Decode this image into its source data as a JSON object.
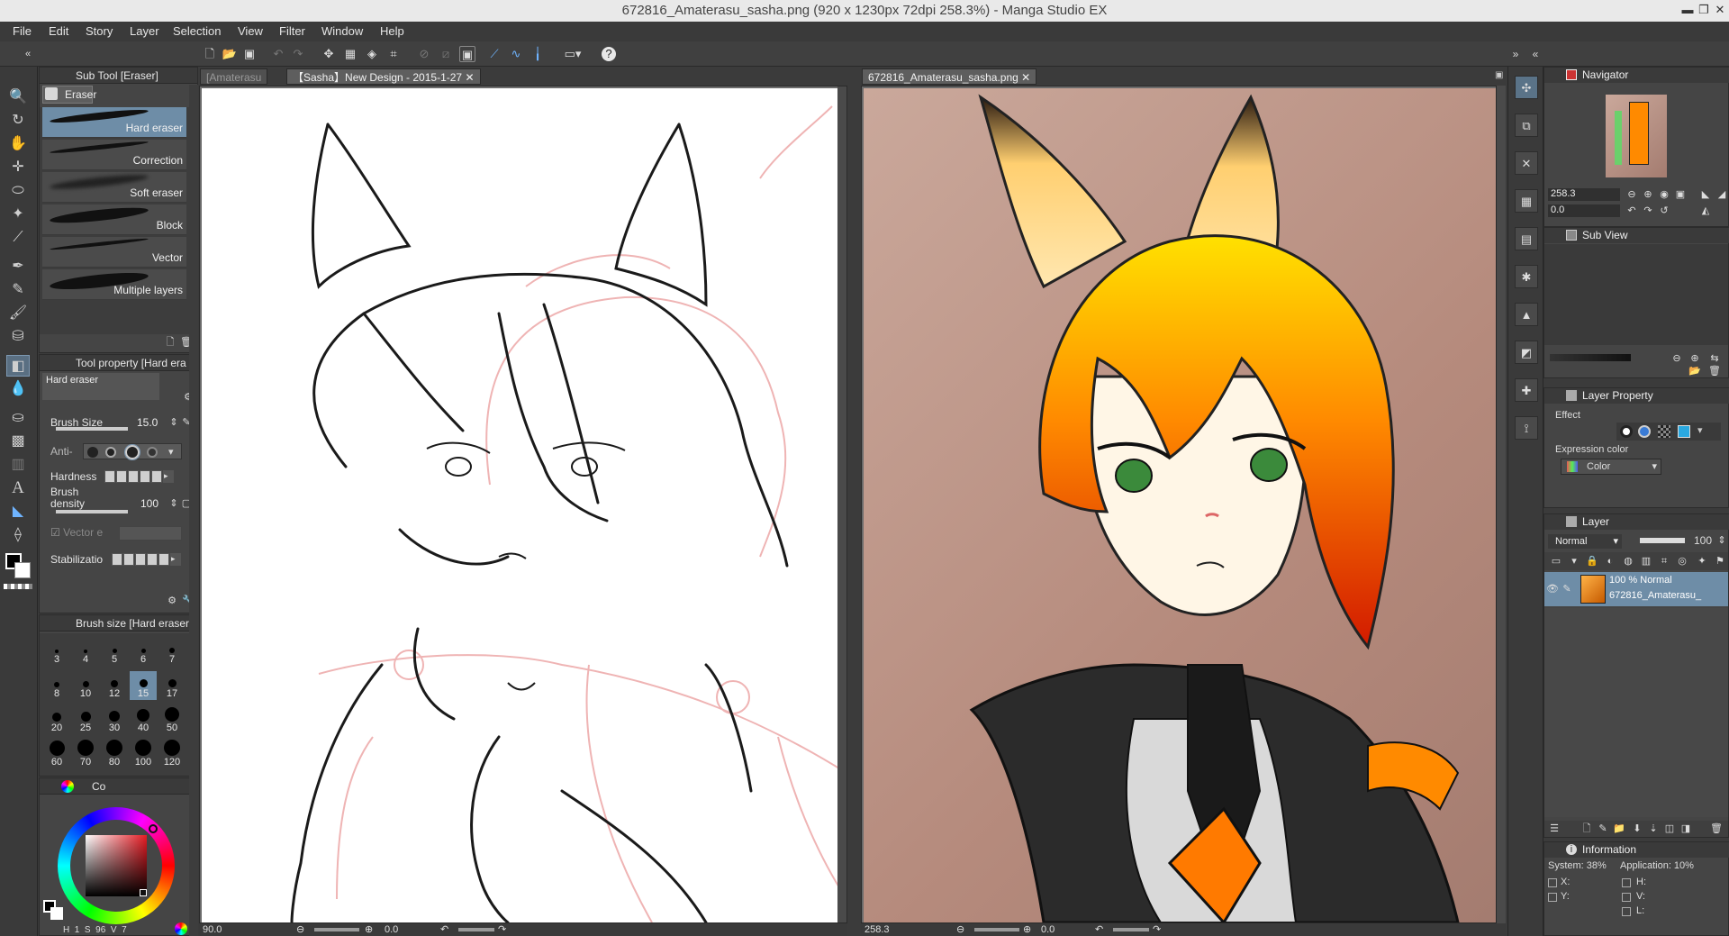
{
  "window": {
    "title": "672816_Amaterasu_sasha.png (920 x 1230px 72dpi 258.3%)  - Manga Studio EX"
  },
  "menu": [
    "File",
    "Edit",
    "Story",
    "Layer",
    "Selection",
    "View",
    "Filter",
    "Window",
    "Help"
  ],
  "sub_tool": {
    "header": "Sub Tool [Eraser]",
    "group": "Eraser",
    "brushes": [
      "Hard eraser",
      "Correction",
      "Soft eraser",
      "Block",
      "Vector",
      "Multiple layers"
    ]
  },
  "tool_property": {
    "header": "Tool property [Hard era",
    "preset": "Hard eraser",
    "brush_size_label": "Brush Size",
    "brush_size": "15.0",
    "anti_label": "Anti-",
    "hardness_label": "Hardness",
    "density_label": "Brush density",
    "density": "100",
    "vector_label": "Vector e",
    "stabilization_label": "Stabilizatio"
  },
  "brush_size_panel": {
    "header": "Brush size [Hard eraser]",
    "sizes": [
      "3",
      "4",
      "5",
      "6",
      "7",
      "8",
      "10",
      "12",
      "15",
      "17",
      "20",
      "25",
      "30",
      "40",
      "50",
      "60",
      "70",
      "80",
      "100",
      "120"
    ],
    "selected": "15"
  },
  "color_panel": {
    "header": "Co",
    "mode_h": "H",
    "val1": "1",
    "mode_s": "S",
    "val2": "96",
    "mode_v": "V",
    "val3": "7",
    "hue_angle_deg": 315
  },
  "canvas_tabs": {
    "left": [
      "[Amaterasu",
      "【Sasha】New Design - 2015-1-27"
    ],
    "right": [
      "672816_Amaterasu_sasha.png"
    ]
  },
  "status": {
    "left_zoom": "90.0",
    "left_angle": "0.0",
    "right_zoom": "258.3",
    "right_angle": "0.0"
  },
  "navigator": {
    "header": "Navigator",
    "zoom": "258.3",
    "angle": "0.0"
  },
  "sub_view": {
    "header": "Sub View"
  },
  "layer_property": {
    "header": "Layer Property",
    "effect_label": "Effect",
    "expression_label": "Expression color",
    "expression_value": "Color"
  },
  "layer_panel": {
    "header": "Layer",
    "blend": "Normal",
    "opacity": "100",
    "layers": [
      {
        "opacity_mode": "100 %  Normal",
        "name": "672816_Amaterasu_"
      }
    ]
  },
  "information": {
    "header": "Information",
    "system": "System: 38%",
    "application": "Application: 10%",
    "x": "X:",
    "y": "Y:",
    "h": "H:",
    "v": "V:",
    "l": "L:"
  },
  "colors": {
    "accent": "#6e8da7",
    "panel": "#454545",
    "dark": "#3a3a3a"
  }
}
